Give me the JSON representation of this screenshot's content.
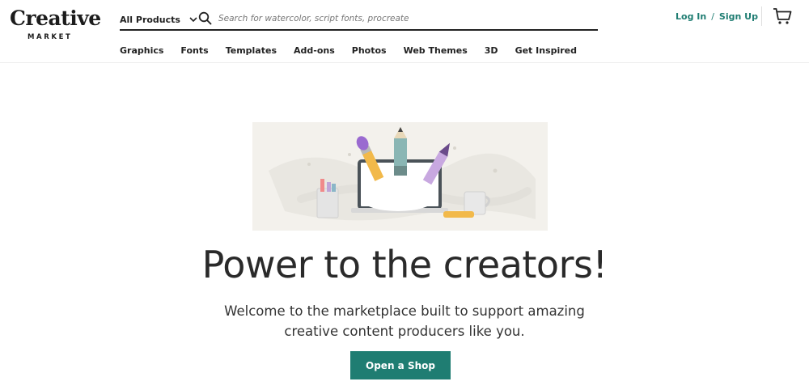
{
  "brand": {
    "logo_word": "Creative",
    "logo_sub": "MARKET"
  },
  "search": {
    "category_label": "All Products",
    "placeholder": "Search for watercolor, script fonts, procreate"
  },
  "auth": {
    "login_label": "Log In",
    "separator": "/",
    "signup_label": "Sign Up"
  },
  "nav": {
    "items": [
      {
        "label": "Graphics"
      },
      {
        "label": "Fonts"
      },
      {
        "label": "Templates"
      },
      {
        "label": "Add-ons"
      },
      {
        "label": "Photos"
      },
      {
        "label": "Web Themes"
      },
      {
        "label": "3D"
      },
      {
        "label": "Get Inspired"
      }
    ]
  },
  "hero": {
    "title": "Power to the creators!",
    "subtitle_line1": "Welcome to the marketplace built to support amazing",
    "subtitle_line2": "creative content producers like you.",
    "cta_label": "Open a Shop"
  },
  "colors": {
    "accent": "#1f7d72",
    "text": "#222222",
    "hero_bg": "#f3f1ec"
  },
  "icons": [
    "chevron-down-icon",
    "search-icon",
    "cart-icon"
  ]
}
